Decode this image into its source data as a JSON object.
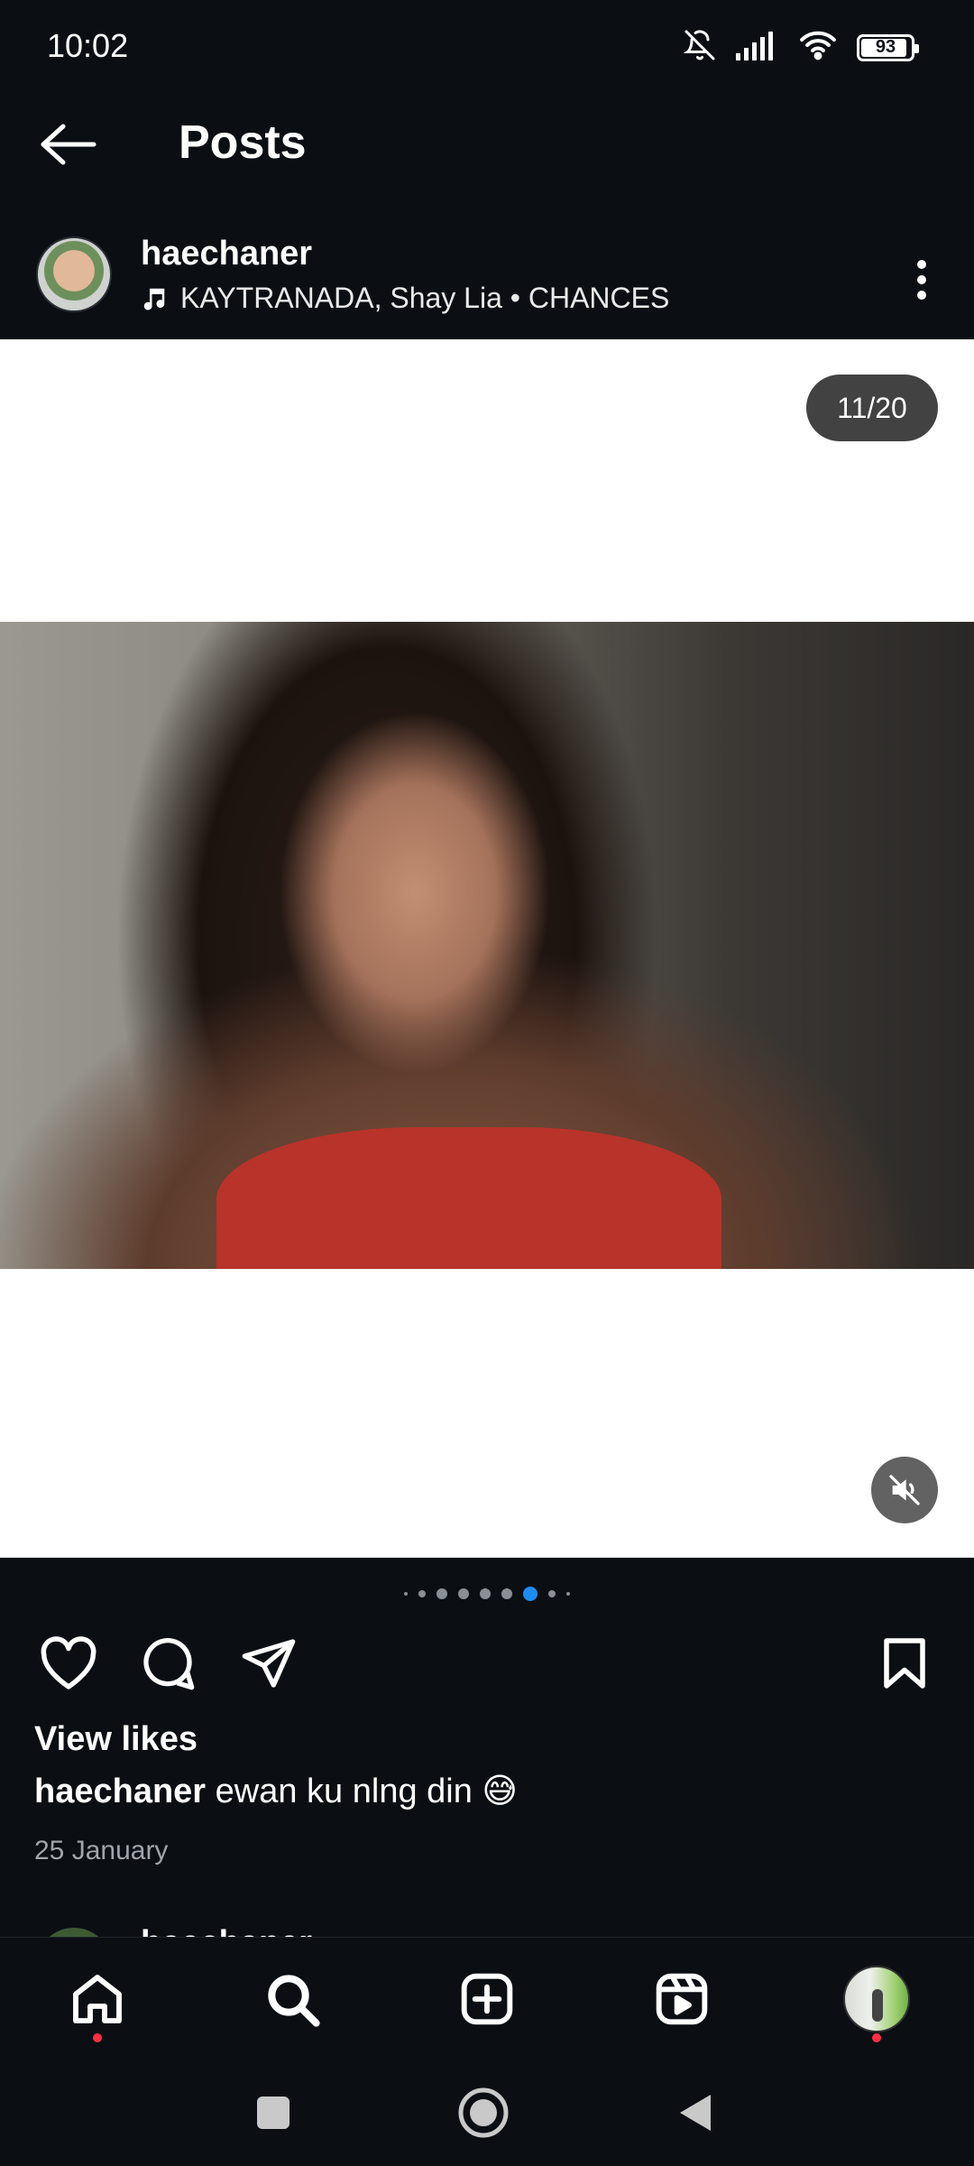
{
  "status_bar": {
    "time": "10:02",
    "battery": "93"
  },
  "header": {
    "title": "Posts"
  },
  "post": {
    "username": "haechaner",
    "music": "KAYTRANADA, Shay Lia • CHANCES",
    "counter": "11/20",
    "view_likes": "View likes",
    "caption_user": "haechaner",
    "caption_text": "ewan ku nlng din 😅",
    "date": "25 January"
  },
  "next_post": {
    "username": "haechaner"
  },
  "carousel": {
    "current": 11,
    "total": 20
  },
  "colors": {
    "background": "#0b0f14",
    "accent": "#1d8cf0",
    "notification": "#ff3040"
  },
  "icons": {
    "status": [
      "mute-bell-icon",
      "signal-icon",
      "wifi-icon",
      "battery-icon"
    ],
    "actions": [
      "heart-icon",
      "comment-icon",
      "share-icon",
      "bookmark-icon"
    ],
    "nav": [
      "home-icon",
      "search-icon",
      "create-icon",
      "reels-icon",
      "profile-avatar"
    ],
    "system": [
      "recents-icon",
      "home-circle-icon",
      "back-triangle-icon"
    ]
  }
}
